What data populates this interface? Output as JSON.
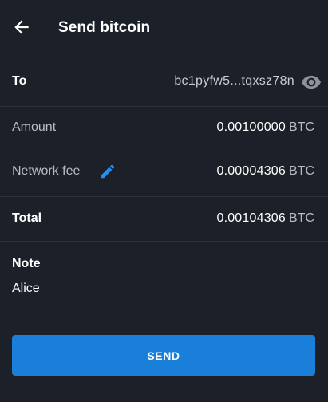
{
  "header": {
    "title": "Send bitcoin",
    "back_icon": "arrow-left-icon"
  },
  "to": {
    "label": "To",
    "address": "bc1pyfw5...tqxsz78n",
    "reveal_icon": "eye-icon"
  },
  "amount": {
    "label": "Amount",
    "value": "0.00100000",
    "unit": "BTC"
  },
  "network_fee": {
    "label": "Network fee",
    "edit_icon": "pencil-icon",
    "value": "0.00004306",
    "unit": "BTC"
  },
  "total": {
    "label": "Total",
    "value": "0.00104306",
    "unit": "BTC"
  },
  "note": {
    "label": "Note",
    "text": "Alice"
  },
  "send_button": {
    "label": "SEND"
  },
  "colors": {
    "background": "#1c2028",
    "accent": "#1a7fd8",
    "divider": "#2b3039",
    "muted_text": "#b8bcc4"
  }
}
